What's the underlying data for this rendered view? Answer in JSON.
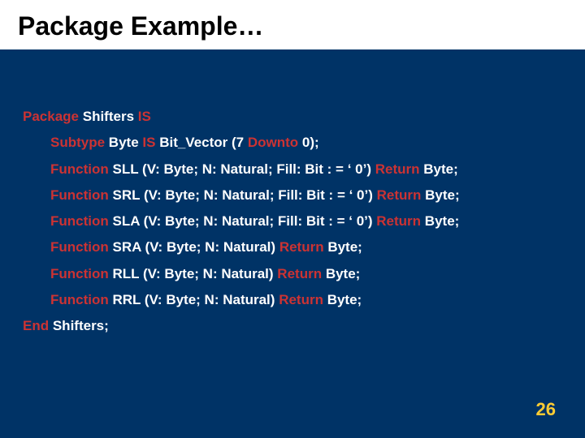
{
  "title": "Package Example…",
  "code": {
    "pkg_kw": "Package",
    "pkg_name": "Shifters",
    "is_kw": "IS",
    "subtype_kw": "Subtype",
    "subtype_name": "Byte",
    "subtype_def": "Bit_Vector (7",
    "downto_kw": "Downto",
    "downto_tail": "0);",
    "func_kw": "Function",
    "return_kw": "Return",
    "ret_type": "Byte;",
    "sll_name": "SLL",
    "srl_name": "SRL",
    "sla_name": "SLA",
    "sra_name": "SRA",
    "rll_name": "RLL",
    "rrl_name": "RRL",
    "args_fill": "(V: Byte; N: Natural; Fill: Bit : = ‘ 0’)",
    "args_no_fill": "(V: Byte; N: Natural)",
    "end_kw": "End",
    "end_tail": "Shifters;"
  },
  "page": "26"
}
